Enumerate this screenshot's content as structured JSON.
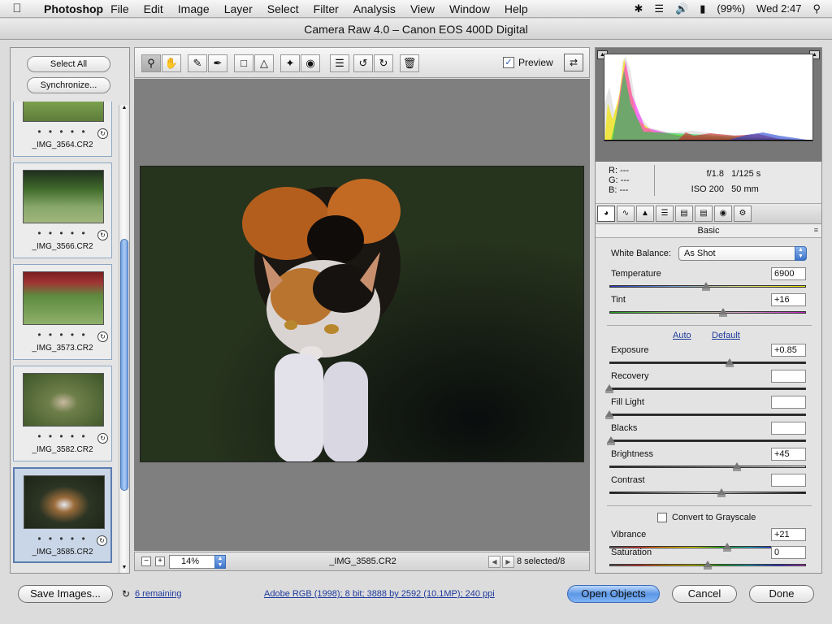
{
  "menubar": {
    "app_name": "Photoshop",
    "items": [
      "File",
      "Edit",
      "Image",
      "Layer",
      "Select",
      "Filter",
      "Analysis",
      "View",
      "Window",
      "Help"
    ],
    "battery": "(99%)",
    "clock": "Wed 2:47"
  },
  "window": {
    "title": "Camera Raw 4.0  –  Canon EOS 400D Digital"
  },
  "filmstrip": {
    "select_all": "Select All",
    "synchronize": "Synchronize...",
    "dots": "• • • • •",
    "thumbnails": [
      {
        "filename": "_IMG_3564.CR2",
        "selected": false
      },
      {
        "filename": "_IMG_3566.CR2",
        "selected": false
      },
      {
        "filename": "_IMG_3573.CR2",
        "selected": false
      },
      {
        "filename": "_IMG_3582.CR2",
        "selected": false
      },
      {
        "filename": "_IMG_3585.CR2",
        "selected": true
      }
    ]
  },
  "toolbar": {
    "preview_label": "Preview",
    "preview_checked": true
  },
  "preview_status": {
    "zoom": "14%",
    "filename": "_IMG_3585.CR2",
    "selected": "8 selected/8"
  },
  "camera_info": {
    "r_label": "R:",
    "g_label": "G:",
    "b_label": "B:",
    "r_value": "---",
    "g_value": "---",
    "b_value": "---",
    "aperture": "f/1.8",
    "shutter": "1/125 s",
    "iso": "ISO 200",
    "focal_length": "50 mm"
  },
  "basic_panel": {
    "title": "Basic",
    "white_balance_label": "White Balance:",
    "white_balance_value": "As Shot",
    "auto": "Auto",
    "default": "Default",
    "convert_grayscale": "Convert to Grayscale",
    "sliders": {
      "temperature": {
        "label": "Temperature",
        "value": "6900",
        "position": 0.49
      },
      "tint": {
        "label": "Tint",
        "value": "+16",
        "position": 0.58
      },
      "exposure": {
        "label": "Exposure",
        "value": "+0.85",
        "position": 0.61
      },
      "recovery": {
        "label": "Recovery",
        "value": "",
        "position": 0.0
      },
      "fill_light": {
        "label": "Fill Light",
        "value": "",
        "position": 0.0
      },
      "blacks": {
        "label": "Blacks",
        "value": "",
        "position": 0.01
      },
      "brightness": {
        "label": "Brightness",
        "value": "+45",
        "position": 0.65
      },
      "contrast": {
        "label": "Contrast",
        "value": "",
        "position": 0.57
      },
      "vibrance": {
        "label": "Vibrance",
        "value": "+21",
        "position": 0.6
      },
      "saturation": {
        "label": "Saturation",
        "value": "0",
        "position": 0.5
      }
    }
  },
  "bottom": {
    "save_images": "Save Images...",
    "remaining": "6 remaining",
    "workflow": "Adobe RGB (1998); 8 bit; 3888 by 2592 (10.1MP); 240 ppi",
    "open_objects": "Open Objects",
    "cancel": "Cancel",
    "done": "Done"
  }
}
